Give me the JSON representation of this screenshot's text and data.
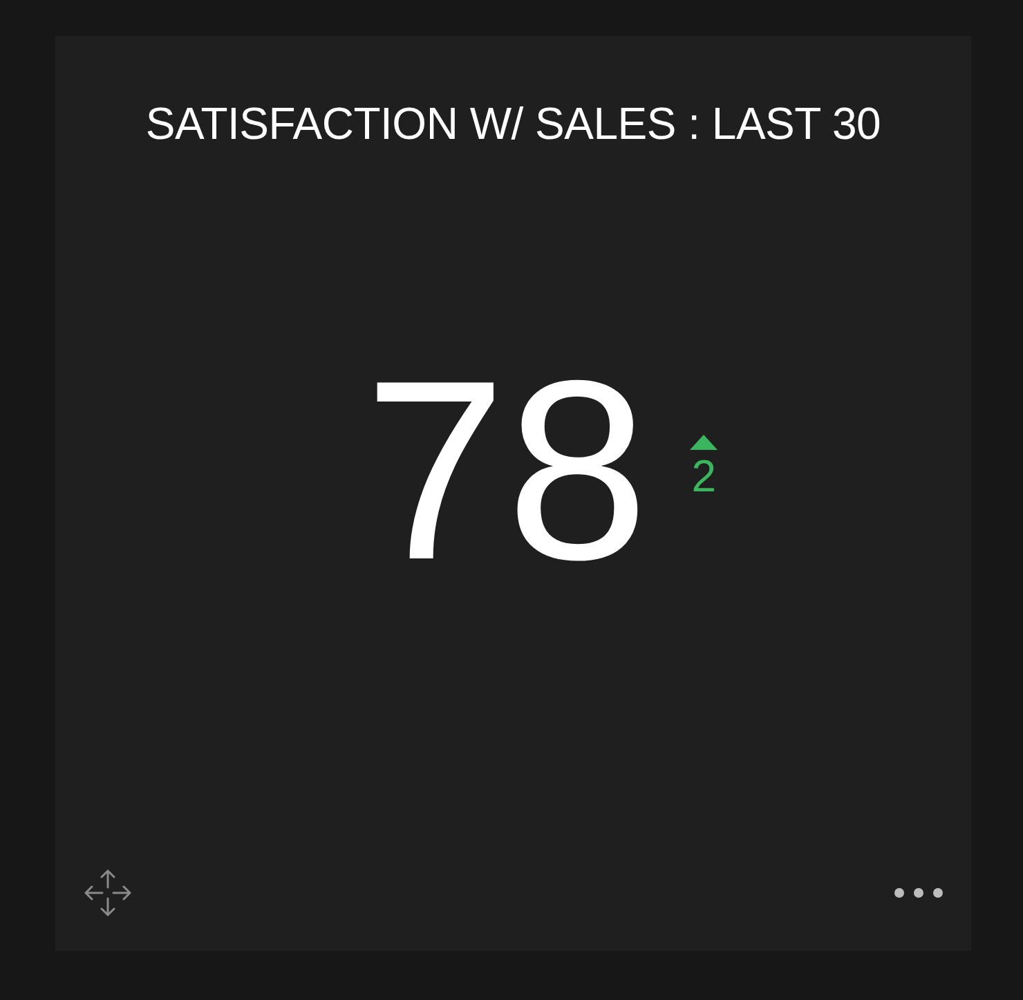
{
  "widget": {
    "title": "SATISFACTION W/ SALES : LAST 30",
    "value": "78",
    "change": {
      "up": true,
      "value": "2"
    }
  }
}
